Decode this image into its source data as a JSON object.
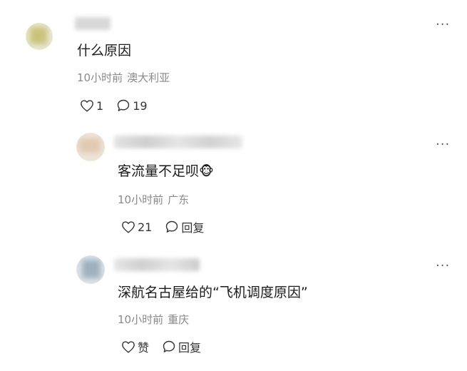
{
  "comments": [
    {
      "content": "什么原因",
      "time": "10小时前",
      "location": "澳大利亚",
      "like_label": "1",
      "reply_label": "19",
      "more_label": "···"
    },
    {
      "content": "客流量不足呗",
      "emoji": "🐵",
      "time": "10小时前",
      "location": "广东",
      "like_label": "21",
      "reply_label": "回复",
      "more_label": "···"
    },
    {
      "content": "深航名古屋给的“飞机调度原因”",
      "time": "10小时前",
      "location": "重庆",
      "like_label": "赞",
      "reply_label": "回复",
      "more_label": "···"
    }
  ],
  "colors": {
    "meta_text": "#8a8a8a",
    "body_text": "#1b1b1b",
    "icon": "#333333"
  },
  "icons": {
    "like": "heart-outline-icon",
    "reply": "speech-bubble-icon",
    "more": "ellipsis-icon"
  }
}
